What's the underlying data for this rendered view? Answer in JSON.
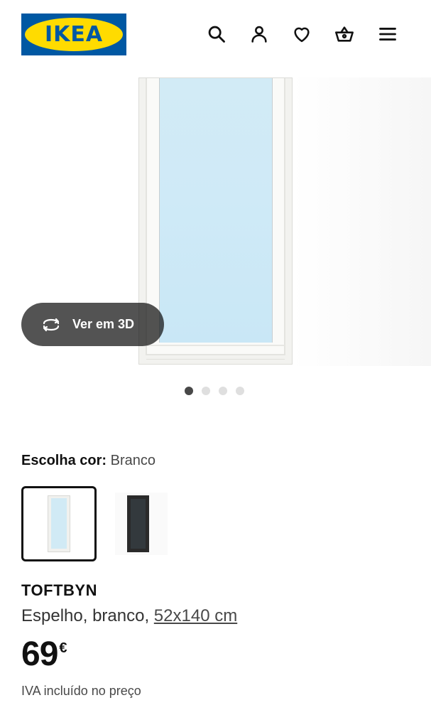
{
  "header": {
    "logo_text": "IKEA",
    "icons": [
      "search-icon",
      "user-icon",
      "heart-icon",
      "basket-icon",
      "menu-icon"
    ]
  },
  "gallery": {
    "view_3d_label": "Ver em 3D",
    "slide_count": 4,
    "active_slide": 1
  },
  "color_picker": {
    "label": "Escolha cor:",
    "selected_value": "Branco",
    "options": [
      "white",
      "black-brown"
    ]
  },
  "product": {
    "name": "TOFTBYN",
    "description_prefix": "Espelho, branco, ",
    "dimensions": "52x140 cm",
    "price_integer": "69",
    "price_currency": "€",
    "vat_note": "IVA incluído no preço"
  },
  "colors": {
    "ikea_blue": "#0058a3",
    "ikea_yellow": "#ffdb00",
    "text": "#111111",
    "muted": "#484848"
  }
}
